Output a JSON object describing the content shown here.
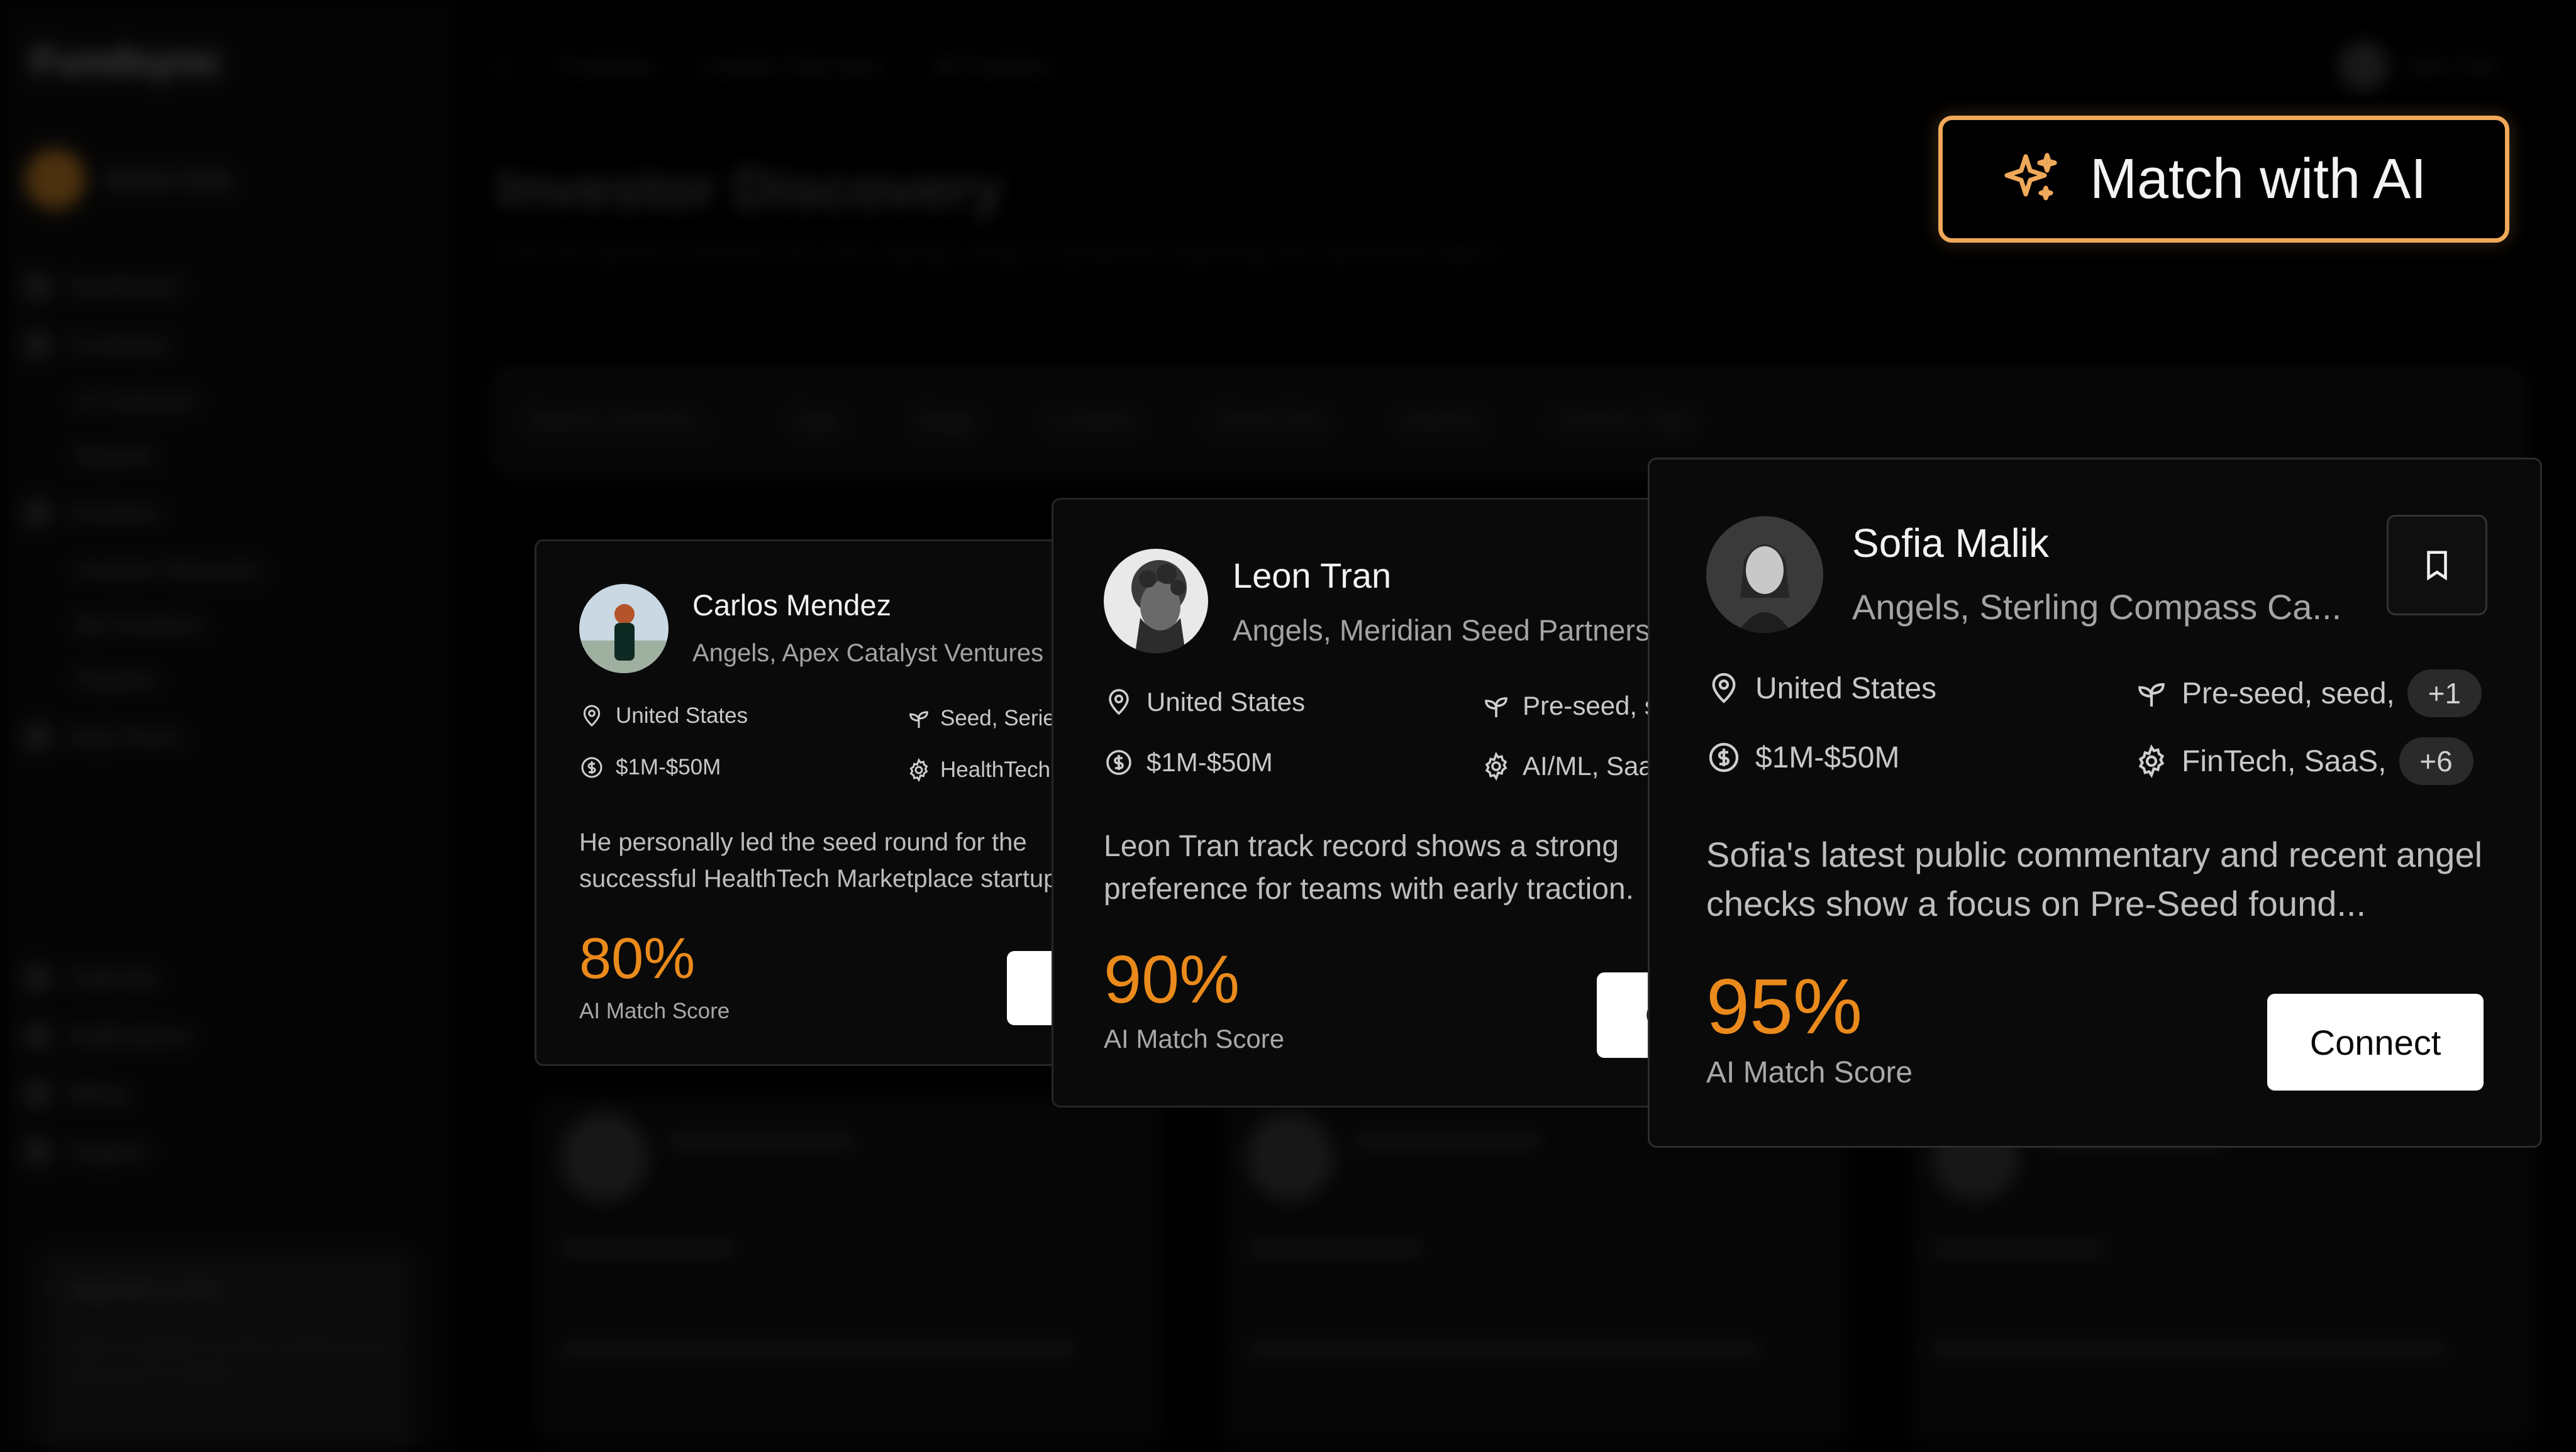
{
  "background": {
    "logo": "Fundsync",
    "workspace": "Acme Corp",
    "nav": [
      "Dashboard",
      "Fundraise",
      "AI Outreach",
      "Reports",
      "Investors",
      "Investor Discovery",
      "My Investors",
      "Pipeline",
      "Data Room"
    ],
    "nav_bottom": [
      "Calendar",
      "Notifications",
      "Billing",
      "Support"
    ],
    "promo_title": "Upgrade to Pro",
    "promo_text": "Unlock unlimited investor matches and advanced AI insights.",
    "breadcrumbs": [
      "Fundraise",
      "Investor Discovery",
      "All Investors"
    ],
    "user_name": "John Doe",
    "page_title": "Investor Discovery",
    "page_subtitle": "Find the perfect investors for your startup using AI-powered matching and advanced filters.",
    "filters": [
      "Search investors...",
      "Type",
      "Stage",
      "Location",
      "Check Size",
      "Industry",
      "Investor Type"
    ]
  },
  "ai_button": {
    "label": "Match with AI",
    "accent": "#f0a85a"
  },
  "cards": [
    {
      "name": "Carlos Mendez",
      "role": "Angels, Apex Catalyst Ventures",
      "location": "United States",
      "check_size": "$1M-$50M",
      "stages": "Seed, Series A",
      "industries": "HealthTech",
      "description": "He personally led the seed round for the successful HealthTech Marketplace startup.",
      "score": "80%",
      "score_label": "AI Match Score",
      "connect_label": "Connect"
    },
    {
      "name": "Leon Tran",
      "role": "Angels, Meridian Seed Partners",
      "location": "United States",
      "check_size": "$1M-$50M",
      "stages": "Pre-seed, seed",
      "industries": "AI/ML, SaaS",
      "description": "Leon Tran track record shows a strong preference for teams with early traction.",
      "score": "90%",
      "score_label": "AI Match Score",
      "connect_label": "Connect"
    },
    {
      "name": "Sofia Malik",
      "role": "Angels, Sterling Compass Ca...",
      "location": "United States",
      "check_size": "$1M-$50M",
      "stages": "Pre-seed, seed,",
      "stages_more": "+1",
      "industries": "FinTech, SaaS,",
      "industries_more": "+6",
      "description": "Sofia's latest public commentary and recent angel checks show a focus on Pre-Seed found...",
      "score": "95%",
      "score_label": "AI Match Score",
      "connect_label": "Connect"
    }
  ],
  "colors": {
    "score": "#ea8a1c",
    "card_bg": "#0a0a0a",
    "card_border": "#262626"
  }
}
